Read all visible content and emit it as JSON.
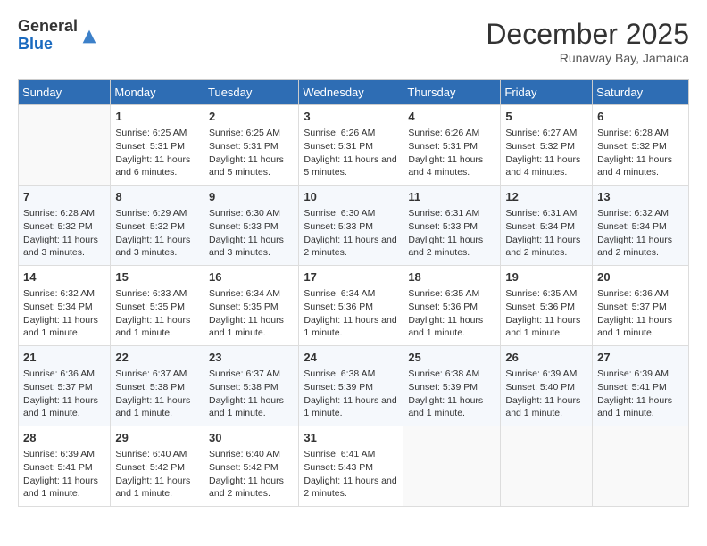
{
  "header": {
    "logo_general": "General",
    "logo_blue": "Blue",
    "month": "December 2025",
    "location": "Runaway Bay, Jamaica"
  },
  "weekdays": [
    "Sunday",
    "Monday",
    "Tuesday",
    "Wednesday",
    "Thursday",
    "Friday",
    "Saturday"
  ],
  "weeks": [
    [
      {
        "day": "",
        "sunrise": "",
        "sunset": "",
        "daylight": ""
      },
      {
        "day": "1",
        "sunrise": "Sunrise: 6:25 AM",
        "sunset": "Sunset: 5:31 PM",
        "daylight": "Daylight: 11 hours and 6 minutes."
      },
      {
        "day": "2",
        "sunrise": "Sunrise: 6:25 AM",
        "sunset": "Sunset: 5:31 PM",
        "daylight": "Daylight: 11 hours and 5 minutes."
      },
      {
        "day": "3",
        "sunrise": "Sunrise: 6:26 AM",
        "sunset": "Sunset: 5:31 PM",
        "daylight": "Daylight: 11 hours and 5 minutes."
      },
      {
        "day": "4",
        "sunrise": "Sunrise: 6:26 AM",
        "sunset": "Sunset: 5:31 PM",
        "daylight": "Daylight: 11 hours and 4 minutes."
      },
      {
        "day": "5",
        "sunrise": "Sunrise: 6:27 AM",
        "sunset": "Sunset: 5:32 PM",
        "daylight": "Daylight: 11 hours and 4 minutes."
      },
      {
        "day": "6",
        "sunrise": "Sunrise: 6:28 AM",
        "sunset": "Sunset: 5:32 PM",
        "daylight": "Daylight: 11 hours and 4 minutes."
      }
    ],
    [
      {
        "day": "7",
        "sunrise": "Sunrise: 6:28 AM",
        "sunset": "Sunset: 5:32 PM",
        "daylight": "Daylight: 11 hours and 3 minutes."
      },
      {
        "day": "8",
        "sunrise": "Sunrise: 6:29 AM",
        "sunset": "Sunset: 5:32 PM",
        "daylight": "Daylight: 11 hours and 3 minutes."
      },
      {
        "day": "9",
        "sunrise": "Sunrise: 6:30 AM",
        "sunset": "Sunset: 5:33 PM",
        "daylight": "Daylight: 11 hours and 3 minutes."
      },
      {
        "day": "10",
        "sunrise": "Sunrise: 6:30 AM",
        "sunset": "Sunset: 5:33 PM",
        "daylight": "Daylight: 11 hours and 2 minutes."
      },
      {
        "day": "11",
        "sunrise": "Sunrise: 6:31 AM",
        "sunset": "Sunset: 5:33 PM",
        "daylight": "Daylight: 11 hours and 2 minutes."
      },
      {
        "day": "12",
        "sunrise": "Sunrise: 6:31 AM",
        "sunset": "Sunset: 5:34 PM",
        "daylight": "Daylight: 11 hours and 2 minutes."
      },
      {
        "day": "13",
        "sunrise": "Sunrise: 6:32 AM",
        "sunset": "Sunset: 5:34 PM",
        "daylight": "Daylight: 11 hours and 2 minutes."
      }
    ],
    [
      {
        "day": "14",
        "sunrise": "Sunrise: 6:32 AM",
        "sunset": "Sunset: 5:34 PM",
        "daylight": "Daylight: 11 hours and 1 minute."
      },
      {
        "day": "15",
        "sunrise": "Sunrise: 6:33 AM",
        "sunset": "Sunset: 5:35 PM",
        "daylight": "Daylight: 11 hours and 1 minute."
      },
      {
        "day": "16",
        "sunrise": "Sunrise: 6:34 AM",
        "sunset": "Sunset: 5:35 PM",
        "daylight": "Daylight: 11 hours and 1 minute."
      },
      {
        "day": "17",
        "sunrise": "Sunrise: 6:34 AM",
        "sunset": "Sunset: 5:36 PM",
        "daylight": "Daylight: 11 hours and 1 minute."
      },
      {
        "day": "18",
        "sunrise": "Sunrise: 6:35 AM",
        "sunset": "Sunset: 5:36 PM",
        "daylight": "Daylight: 11 hours and 1 minute."
      },
      {
        "day": "19",
        "sunrise": "Sunrise: 6:35 AM",
        "sunset": "Sunset: 5:36 PM",
        "daylight": "Daylight: 11 hours and 1 minute."
      },
      {
        "day": "20",
        "sunrise": "Sunrise: 6:36 AM",
        "sunset": "Sunset: 5:37 PM",
        "daylight": "Daylight: 11 hours and 1 minute."
      }
    ],
    [
      {
        "day": "21",
        "sunrise": "Sunrise: 6:36 AM",
        "sunset": "Sunset: 5:37 PM",
        "daylight": "Daylight: 11 hours and 1 minute."
      },
      {
        "day": "22",
        "sunrise": "Sunrise: 6:37 AM",
        "sunset": "Sunset: 5:38 PM",
        "daylight": "Daylight: 11 hours and 1 minute."
      },
      {
        "day": "23",
        "sunrise": "Sunrise: 6:37 AM",
        "sunset": "Sunset: 5:38 PM",
        "daylight": "Daylight: 11 hours and 1 minute."
      },
      {
        "day": "24",
        "sunrise": "Sunrise: 6:38 AM",
        "sunset": "Sunset: 5:39 PM",
        "daylight": "Daylight: 11 hours and 1 minute."
      },
      {
        "day": "25",
        "sunrise": "Sunrise: 6:38 AM",
        "sunset": "Sunset: 5:39 PM",
        "daylight": "Daylight: 11 hours and 1 minute."
      },
      {
        "day": "26",
        "sunrise": "Sunrise: 6:39 AM",
        "sunset": "Sunset: 5:40 PM",
        "daylight": "Daylight: 11 hours and 1 minute."
      },
      {
        "day": "27",
        "sunrise": "Sunrise: 6:39 AM",
        "sunset": "Sunset: 5:41 PM",
        "daylight": "Daylight: 11 hours and 1 minute."
      }
    ],
    [
      {
        "day": "28",
        "sunrise": "Sunrise: 6:39 AM",
        "sunset": "Sunset: 5:41 PM",
        "daylight": "Daylight: 11 hours and 1 minute."
      },
      {
        "day": "29",
        "sunrise": "Sunrise: 6:40 AM",
        "sunset": "Sunset: 5:42 PM",
        "daylight": "Daylight: 11 hours and 1 minute."
      },
      {
        "day": "30",
        "sunrise": "Sunrise: 6:40 AM",
        "sunset": "Sunset: 5:42 PM",
        "daylight": "Daylight: 11 hours and 2 minutes."
      },
      {
        "day": "31",
        "sunrise": "Sunrise: 6:41 AM",
        "sunset": "Sunset: 5:43 PM",
        "daylight": "Daylight: 11 hours and 2 minutes."
      },
      {
        "day": "",
        "sunrise": "",
        "sunset": "",
        "daylight": ""
      },
      {
        "day": "",
        "sunrise": "",
        "sunset": "",
        "daylight": ""
      },
      {
        "day": "",
        "sunrise": "",
        "sunset": "",
        "daylight": ""
      }
    ]
  ]
}
